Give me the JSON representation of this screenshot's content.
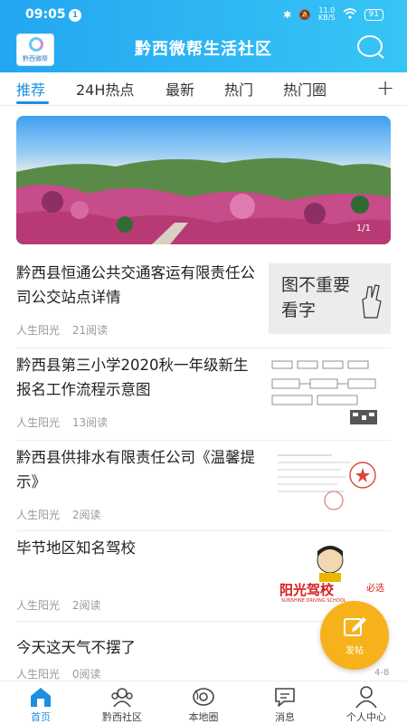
{
  "status_bar": {
    "time": "09:05",
    "notification_count": "1",
    "network_speed": "11.0",
    "network_unit": "KB/S",
    "battery": "91"
  },
  "header": {
    "logo_label": "黔西微帮",
    "title": "黔西微帮生活社区"
  },
  "tabs": [
    {
      "label": "推荐",
      "active": true
    },
    {
      "label": "24H热点"
    },
    {
      "label": "最新"
    },
    {
      "label": "热门"
    },
    {
      "label": "热门圈"
    }
  ],
  "banner": {
    "counter": "1/1"
  },
  "news": [
    {
      "title": "黔西县恒通公共交通客运有限责任公司公交站点详情",
      "author": "人生阳光",
      "reads": "21阅读",
      "thumb_text": "图不重要 看字"
    },
    {
      "title": "黔西县第三小学2020秋一年级新生报名工作流程示意图",
      "author": "人生阳光",
      "reads": "13阅读"
    },
    {
      "title": "黔西县供排水有限责任公司《温馨提示》",
      "author": "人生阳光",
      "reads": "2阅读"
    },
    {
      "title": "毕节地区知名驾校",
      "author": "人生阳光",
      "reads": "2阅读",
      "thumb_text": "阳光驾校",
      "thumb_sub": "SUNSHINE DRIVING SCHOOL",
      "thumb_side": "必选"
    },
    {
      "title": "今天这天气不摆了",
      "author": "人生阳光",
      "reads": "0阅读"
    }
  ],
  "post_button": {
    "label": "发帖"
  },
  "page_indicator": "4-8",
  "bottom_nav": [
    {
      "label": "首页",
      "icon": "home-icon",
      "active": true
    },
    {
      "label": "黔西社区",
      "icon": "community-icon"
    },
    {
      "label": "本地圈",
      "icon": "local-circle-icon"
    },
    {
      "label": "消息",
      "icon": "message-icon"
    },
    {
      "label": "个人中心",
      "icon": "user-icon"
    }
  ],
  "colors": {
    "primary": "#1e8fe0",
    "header_gradient_start": "#23a6f2",
    "header_gradient_end": "#37c5f4",
    "post_button": "#f7b21b"
  }
}
